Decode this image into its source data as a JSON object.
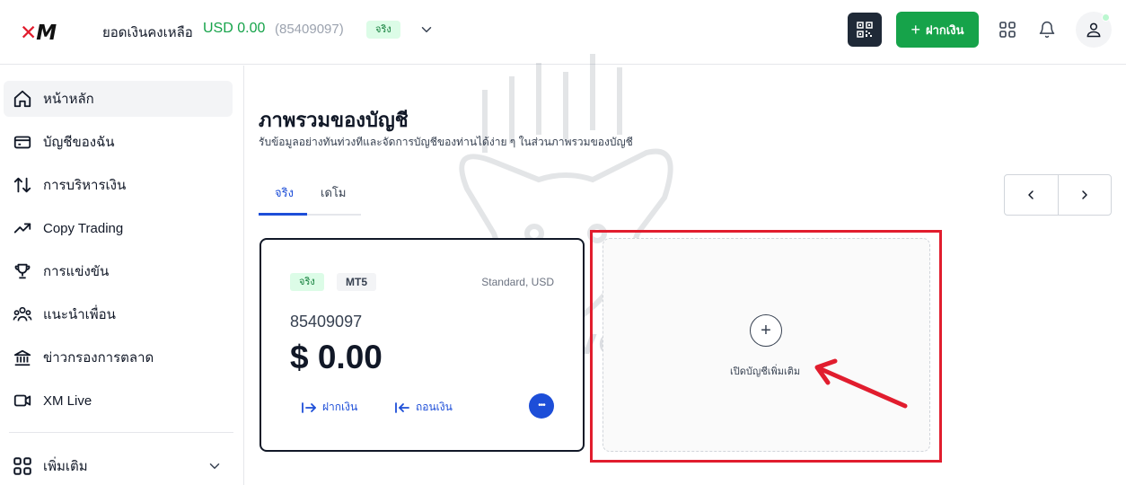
{
  "header": {
    "logo": "XM",
    "balance_label": "ยอดเงินคงเหลือ",
    "balance_value": "USD 0.00",
    "account_id": "(85409097)",
    "account_badge": "จริง",
    "deposit_label": "ฝากเงิน"
  },
  "sidebar": {
    "items": [
      {
        "label": "หน้าหลัก",
        "icon": "home-icon"
      },
      {
        "label": "บัญชีของฉัน",
        "icon": "wallet-icon"
      },
      {
        "label": "การบริหารเงิน",
        "icon": "transfer-icon"
      },
      {
        "label": "Copy Trading",
        "icon": "trend-icon"
      },
      {
        "label": "การแข่งขัน",
        "icon": "trophy-icon"
      },
      {
        "label": "แนะนำเพื่อน",
        "icon": "people-icon"
      },
      {
        "label": "ข่าวกรองการตลาด",
        "icon": "bank-icon"
      },
      {
        "label": "XM Live",
        "icon": "video-icon"
      }
    ],
    "more_label": "เพิ่มเติม"
  },
  "main": {
    "title": "ภาพรวมของบัญชี",
    "subtitle": "รับข้อมูลอย่างทันท่วงทีและจัดการบัญชีของท่านได้ง่าย ๆ ในส่วนภาพรวมของบัญชี",
    "tabs": [
      {
        "label": "จริง",
        "active": true
      },
      {
        "label": "เดโม",
        "active": false
      }
    ]
  },
  "account_card": {
    "badge_real": "จริง",
    "platform": "MT5",
    "type": "Standard, USD",
    "number": "85409097",
    "balance": "$ 0.00",
    "deposit_label": "ฝากเงิน",
    "withdraw_label": "ถอนเงิน",
    "more": "•••"
  },
  "add_account": {
    "label": "เปิดบัญชีเพิ่มเติม",
    "plus": "+"
  },
  "watermark": {
    "text": "FTT Investing"
  },
  "colors": {
    "accent_green": "#16a34a",
    "accent_blue": "#1d4ed8",
    "highlight_red": "#e11d2e"
  }
}
